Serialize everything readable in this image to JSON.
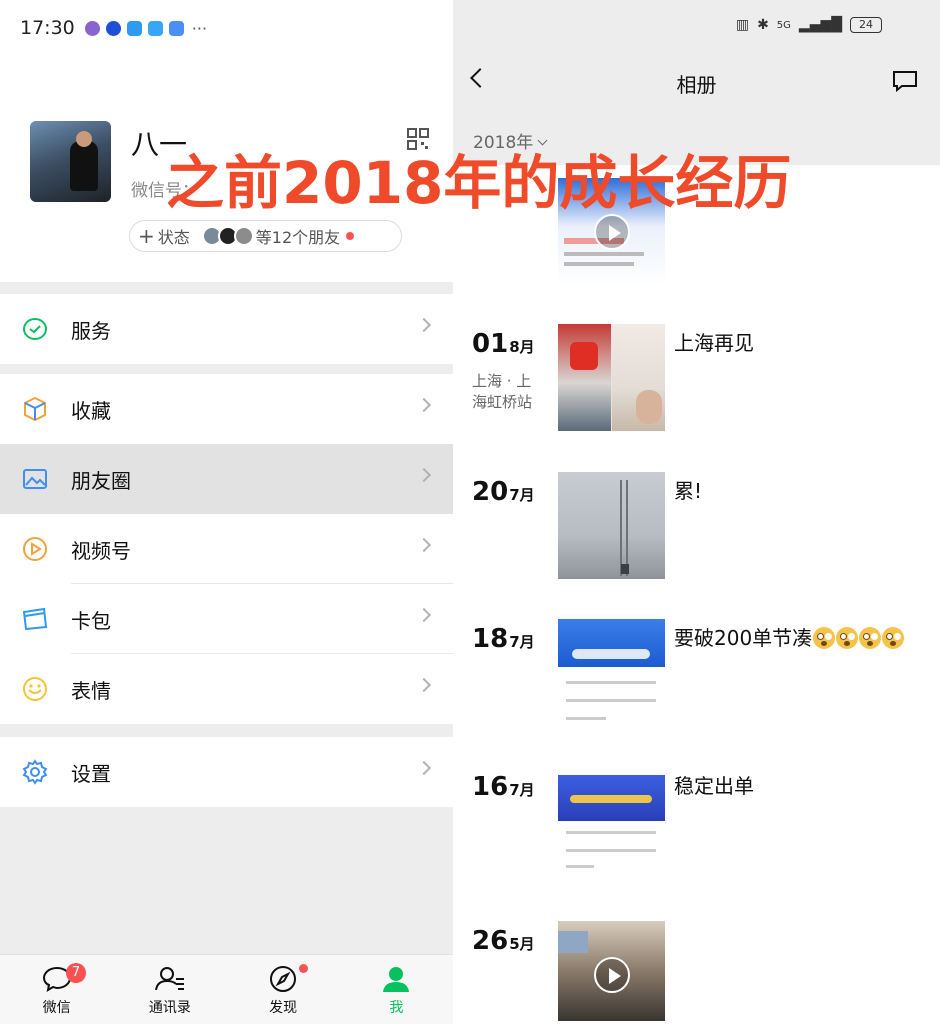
{
  "status_left": {
    "time": "17:30",
    "more": "···"
  },
  "profile": {
    "name": "八一",
    "wechat_id_label": "微信号：",
    "status_label": "状态",
    "friends_label": "等12个朋友"
  },
  "menu": {
    "service": "服务",
    "favorites": "收藏",
    "moments": "朋友圈",
    "channels": "视频号",
    "card_wallet": "卡包",
    "stickers": "表情",
    "settings": "设置"
  },
  "tabbar": {
    "chats": "微信",
    "chats_badge": "7",
    "contacts": "通讯录",
    "discover": "发现",
    "me": "我",
    "active_color": "#07c160"
  },
  "status_right": {
    "network": "5G",
    "battery": "24"
  },
  "album": {
    "title": "相册",
    "year": "2018年",
    "posts": [
      {
        "day": "01",
        "month": "8月",
        "location": "上海 · 上海虹桥站",
        "text": "上海再见"
      },
      {
        "day": "20",
        "month": "7月",
        "text": "累!"
      },
      {
        "day": "18",
        "month": "7月",
        "text": "要破200单节凑"
      },
      {
        "day": "16",
        "month": "7月",
        "text": "稳定出单"
      },
      {
        "day": "26",
        "month": "5月",
        "text": ""
      }
    ]
  },
  "overlay": {
    "caption": "之前2018年的成长经历",
    "color": "#ef4a2a"
  },
  "icons": {
    "service": "service-check-icon",
    "favorites": "cube-icon",
    "moments": "picture-icon",
    "channels": "play-circle-icon",
    "card_wallet": "card-icon",
    "stickers": "smile-icon",
    "settings": "gear-icon"
  }
}
